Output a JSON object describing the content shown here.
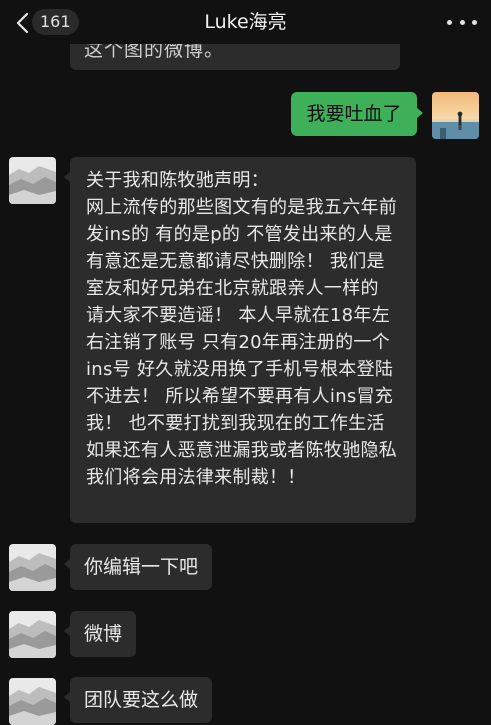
{
  "header": {
    "unread_count": "161",
    "title": "Luke海亮"
  },
  "colors": {
    "background": "#111111",
    "bubble_incoming": "#2c2c2c",
    "bubble_outgoing": "#3fb05a"
  },
  "messages": [
    {
      "id": "m0",
      "direction": "incoming",
      "text": "这个图的微博。",
      "partially_visible": true
    },
    {
      "id": "m1",
      "direction": "outgoing",
      "text": "我要吐血了"
    },
    {
      "id": "m2",
      "direction": "incoming",
      "text": "关于我和陈牧驰声明：\n网上流传的那些图文有的是我五六年前发ins的 有的是p的 不管发出来的人是有意还是无意都请尽快删除！ 我们是室友和好兄弟在北京就跟亲人一样的 请大家不要造谣！ 本人早就在18年左右注销了账号 只有20年再注册的一个ins号 好久就没用换了手机号根本登陆不进去！ 所以希望不要再有人ins冒充我！ 也不要打扰到我现在的工作生活 如果还有人恶意泄漏我或者陈牧驰隐私我们将会用法律来制裁！！"
    },
    {
      "id": "m3",
      "direction": "incoming",
      "text": "你编辑一下吧"
    },
    {
      "id": "m4",
      "direction": "incoming",
      "text": "微博"
    },
    {
      "id": "m5",
      "direction": "incoming",
      "text": "团队要这么做"
    }
  ]
}
